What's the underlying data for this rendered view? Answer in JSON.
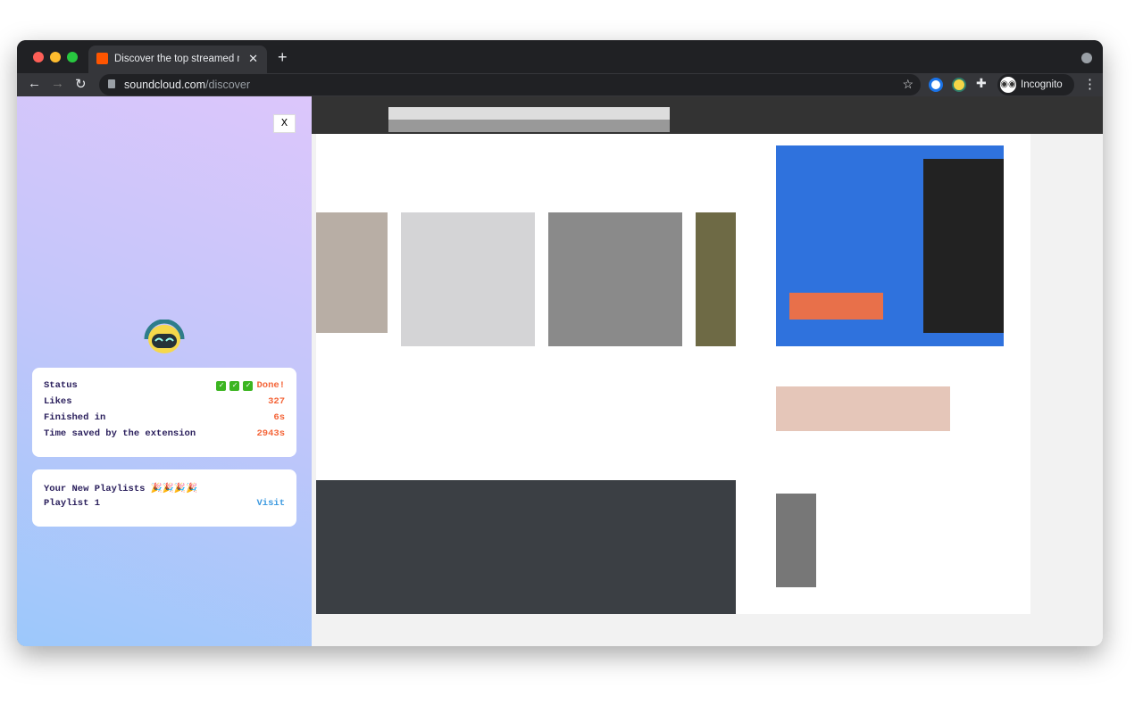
{
  "browser": {
    "tab_title": "Discover the top streamed music",
    "tab_close": "✕",
    "new_tab": "+",
    "url_host": "soundcloud.com",
    "url_path": "/discover",
    "profile_label": "Incognito",
    "profile_icon": "incognito-icon"
  },
  "extension": {
    "close_label": "X",
    "status_card": {
      "rows": [
        {
          "label": "Status",
          "value": "Done!",
          "checks": 3
        },
        {
          "label": "Likes",
          "value": "327"
        },
        {
          "label": "Finished in",
          "value": "6s"
        },
        {
          "label": "Time saved by the extension",
          "value": "2943s"
        }
      ]
    },
    "playlists_card": {
      "title": "Your New Playlists 🎉🎉🎉🎉",
      "items": [
        {
          "name": "Playlist 1",
          "action": "Visit"
        }
      ]
    },
    "colors": {
      "value": "#f4663a",
      "link": "#3f9be0",
      "label": "#2a1f5c"
    }
  }
}
